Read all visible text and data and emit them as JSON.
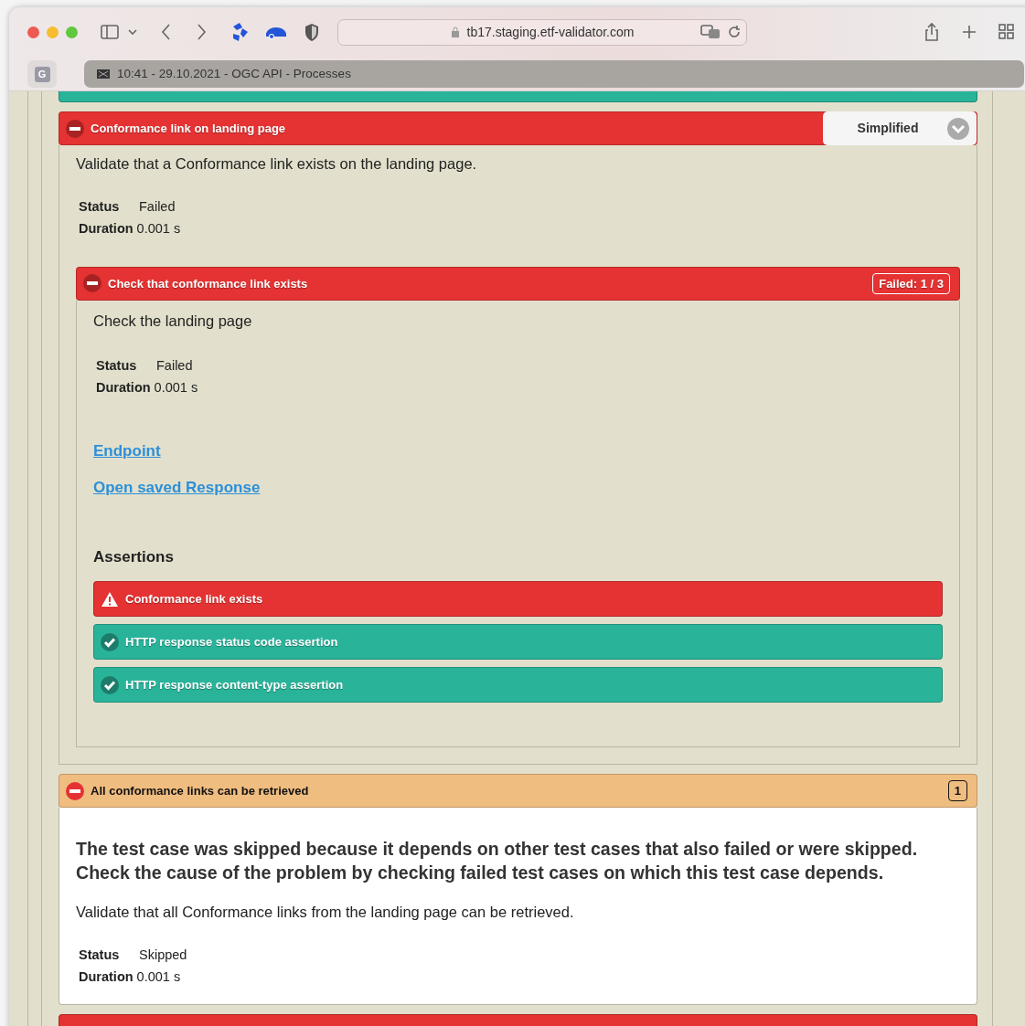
{
  "browser": {
    "url": "tb17.staging.etf-validator.com",
    "tab_title": "10:41 - 29.10.2021 - OGC API - Processes",
    "profile": "G"
  },
  "view_select": {
    "value": "Simplified"
  },
  "test_cases": [
    {
      "kind": "passed"
    },
    {
      "kind": "failed",
      "title": "Conformance link on landing page",
      "description": "Validate that a Conformance link exists on the landing page.",
      "status_label": "Status",
      "status_value": "Failed",
      "duration_label": "Duration",
      "duration_value": "0.001 s",
      "steps": [
        {
          "kind": "failed",
          "title": "Check that conformance link exists",
          "badge": "Failed: 1 / 3",
          "description": "Check the landing page",
          "status_label": "Status",
          "status_value": "Failed",
          "duration_label": "Duration",
          "duration_value": "0.001 s",
          "links": [
            "Endpoint",
            "Open saved Response"
          ],
          "assertions_heading": "Assertions",
          "assertions": [
            {
              "kind": "failed",
              "title": "Conformance link exists"
            },
            {
              "kind": "passed",
              "title": "HTTP response status code assertion"
            },
            {
              "kind": "passed",
              "title": "HTTP response content-type assertion"
            }
          ]
        }
      ]
    },
    {
      "kind": "skipped",
      "title": "All conformance links can be retrieved",
      "badge": "1",
      "notice": "The test case was skipped because it depends on other test cases that also failed or were skipped. Check the cause of the problem by checking failed test cases on which this test case depends.",
      "description": "Validate that all Conformance links from the landing page can be retrieved.",
      "status_label": "Status",
      "status_value": "Skipped",
      "duration_label": "Duration",
      "duration_value": "0.001 s"
    },
    {
      "kind": "failed"
    }
  ]
}
